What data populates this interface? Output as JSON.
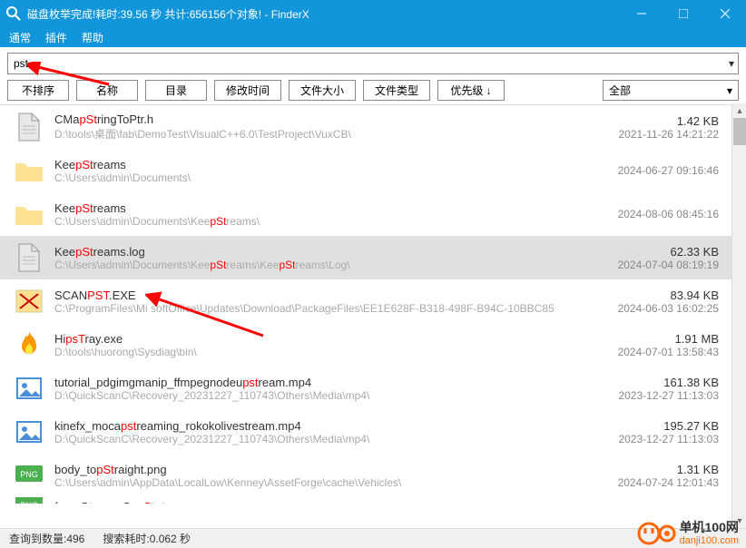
{
  "title": "磁盘枚举完成!耗时:39.56 秒 共计:656156个对象!   - FinderX",
  "menus": {
    "normal": "通常",
    "plugin": "插件",
    "help": "帮助"
  },
  "search": {
    "value": "pst"
  },
  "filters": {
    "nosort": "不排序",
    "name": "名称",
    "dir": "目录",
    "mtime": "修改时间",
    "size": "文件大小",
    "type": "文件类型",
    "priority": "优先级 ↓",
    "all": "全部"
  },
  "rows": [
    {
      "name_pre": "CMa",
      "name_hl": "pSt",
      "name_post": "ringToPtr.h",
      "path_pre": "D:\\tools\\桌面\\fab\\DemoTest\\VisualC++6.0\\TestProject\\VuxCB\\",
      "path_hl": "",
      "path_post": "",
      "size": "1.42 KB",
      "date": "2021-11-26 14:21:22",
      "icon": "file",
      "selected": false
    },
    {
      "name_pre": "Kee",
      "name_hl": "pSt",
      "name_post": "reams",
      "path_pre": "C:\\Users\\admin\\Documents\\",
      "path_hl": "",
      "path_post": "",
      "size": "",
      "date": "2024-06-27 09:16:46",
      "icon": "folder",
      "selected": false
    },
    {
      "name_pre": "Kee",
      "name_hl": "pSt",
      "name_post": "reams",
      "path_pre": "C:\\Users\\admin\\Documents\\Kee",
      "path_hl": "pSt",
      "path_post": "reams\\",
      "size": "",
      "date": "2024-08-06 08:45:16",
      "icon": "folder",
      "selected": false
    },
    {
      "name_pre": "Kee",
      "name_hl": "pSt",
      "name_post": "reams.log",
      "path_pre": "C:\\Users\\admin\\Documents\\Kee",
      "path_hl": "pSt",
      "path_mid": "reams\\Kee",
      "path_hl2": "pSt",
      "path_post": "reams\\Log\\",
      "size": "62.33 KB",
      "date": "2024-07-04 08:19:19",
      "icon": "file",
      "selected": true
    },
    {
      "name_pre": "SCAN",
      "name_hl": "PST",
      "name_post": ".EXE",
      "path_pre": "C:\\ProgramFiles\\Mi    softOffice\\Updates\\Download\\PackageFiles\\EE1E628F-B318-498F-B94C-10BBC85",
      "path_hl": "",
      "path_post": "",
      "size": "83.94 KB",
      "date": "2024-06-03 16:02:25",
      "icon": "exe-x",
      "selected": false
    },
    {
      "name_pre": "Hi",
      "name_hl": "psT",
      "name_post": "ray.exe",
      "path_pre": "D:\\tools\\huorong\\Sysdiag\\bin\\",
      "path_hl": "",
      "path_post": "",
      "size": "1.91 MB",
      "date": "2024-07-01 13:58:43",
      "icon": "fire",
      "selected": false
    },
    {
      "name_pre": "tutorial_pdgimgmanip_ffmpegnodeu",
      "name_hl": "pst",
      "name_post": "ream.mp4",
      "path_pre": "D:\\QuickScanC\\Recovery_20231227_110743\\Others\\Media\\mp4\\",
      "path_hl": "",
      "path_post": "",
      "size": "161.38 KB",
      "date": "2023-12-27 11:13:03",
      "icon": "img",
      "selected": false
    },
    {
      "name_pre": "kinefx_moca",
      "name_hl": "pst",
      "name_post": "reaming_rokokolivestream.mp4",
      "path_pre": "D:\\QuickScanC\\Recovery_20231227_110743\\Others\\Media\\mp4\\",
      "path_hl": "",
      "path_post": "",
      "size": "195.27 KB",
      "date": "2023-12-27 11:13:03",
      "icon": "img",
      "selected": false
    },
    {
      "name_pre": "body_to",
      "name_hl": "pSt",
      "name_post": "raight.png",
      "path_pre": "C:\\Users\\admin\\AppData\\LocalLow\\Kenney\\AssetForge\\cache\\Vehicles\\",
      "path_hl": "",
      "path_post": "",
      "size": "1.31 KB",
      "date": "2024-07-24 12:01:43",
      "icon": "png",
      "selected": false
    },
    {
      "name_pre": "forceStorageCa",
      "name_hl": "pSt",
      "name_post": "ate.png",
      "path_pre": "",
      "path_hl": "",
      "path_post": "",
      "size": "",
      "date": "",
      "icon": "png",
      "selected": false,
      "partial": true
    }
  ],
  "status": {
    "count": "查询到数量:496",
    "time": "搜索耗时:0.062 秒"
  },
  "watermark": {
    "main": "单机100网",
    "sub": "danji100.com"
  }
}
